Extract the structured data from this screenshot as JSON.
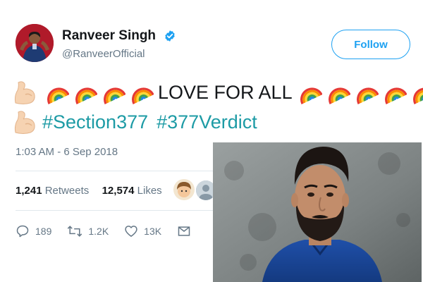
{
  "user": {
    "display_name": "Ranveer Singh",
    "handle": "@RanveerOfficial",
    "verified": true
  },
  "follow_label": "Follow",
  "tweet": {
    "text": "LOVE FOR ALL",
    "hashtags": [
      "#Section377",
      "#377Verdict"
    ],
    "emojis": [
      "flexed-biceps",
      "rainbow"
    ]
  },
  "timestamp": "1:03 AM - 6 Sep 2018",
  "stats": {
    "retweets_count": "1,241",
    "retweets_label": "Retweets",
    "likes_count": "12,574",
    "likes_label": "Likes"
  },
  "actions": {
    "replies": "189",
    "retweets": "1.2K",
    "likes": "13K"
  },
  "colors": {
    "accent": "#1da1f2",
    "hashtag": "#1d9ba5",
    "secondary_text": "#657786"
  }
}
